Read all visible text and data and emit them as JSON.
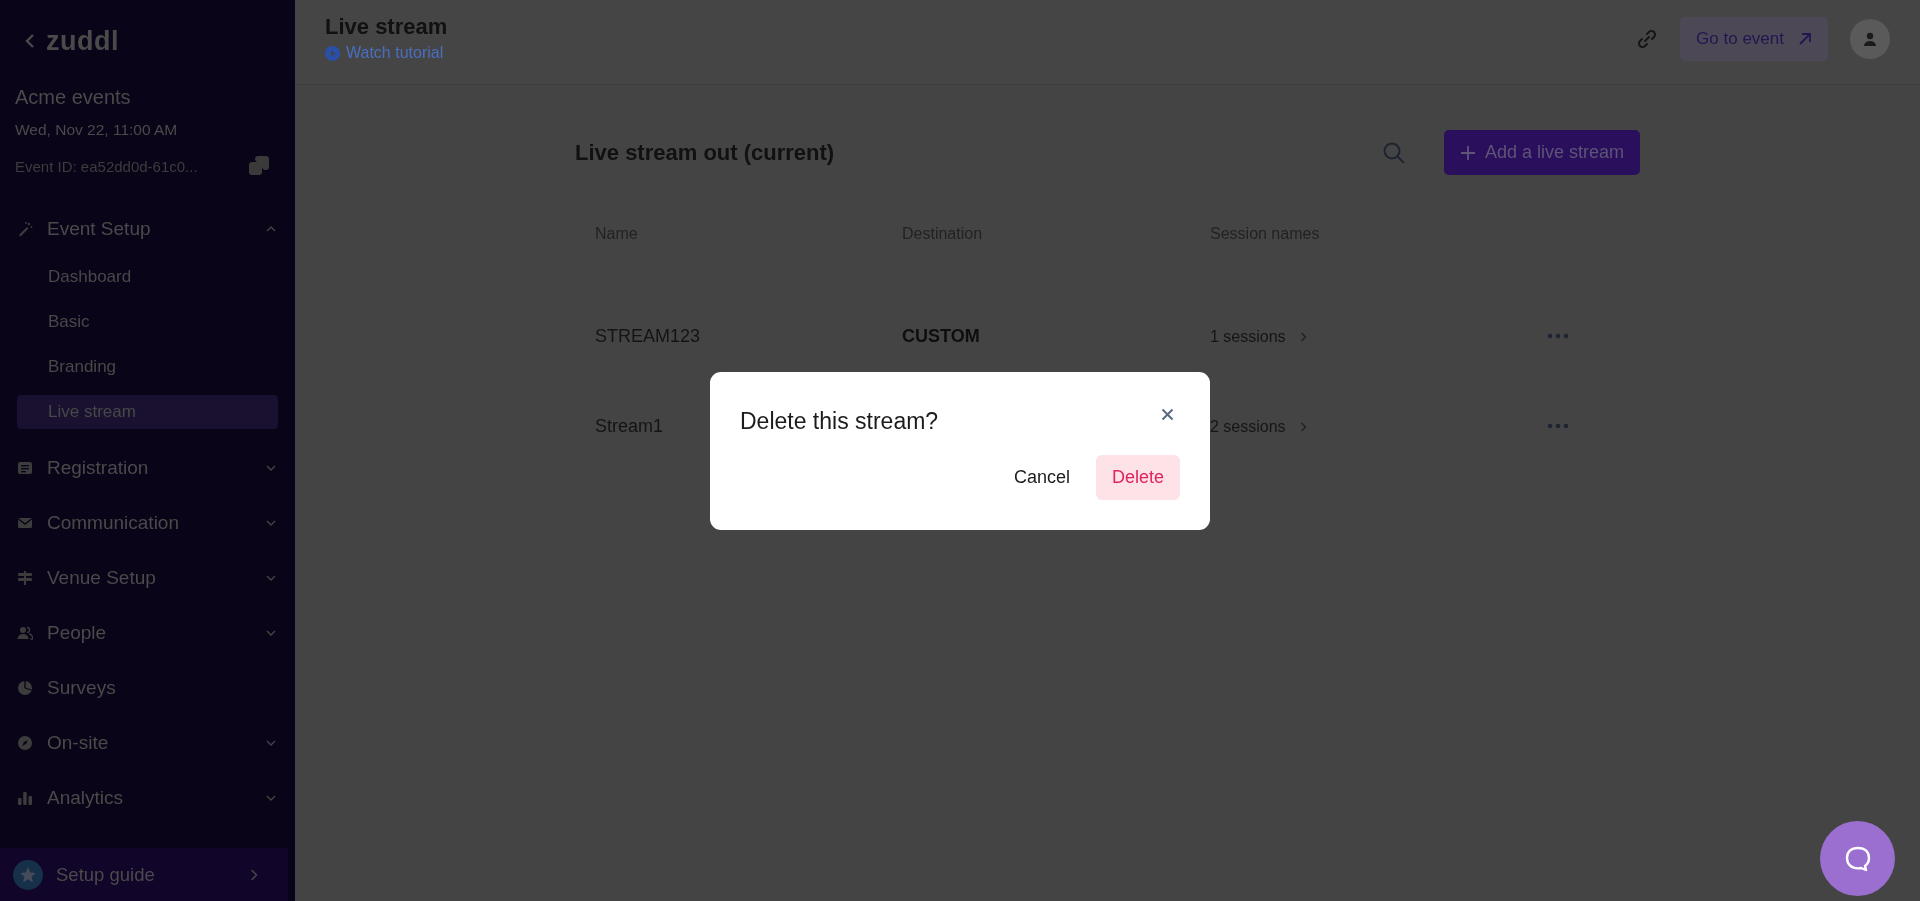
{
  "sidebar": {
    "logo": "zuddl",
    "event_name": "Acme events",
    "event_date": "Wed, Nov 22, 11:00 AM",
    "event_id": "Event ID: ea52dd0d-61c0...",
    "nav": [
      {
        "label": "Event Setup",
        "kind": "group",
        "expanded": true,
        "children": [
          {
            "label": "Dashboard",
            "selected": false
          },
          {
            "label": "Basic",
            "selected": false
          },
          {
            "label": "Branding",
            "selected": false
          },
          {
            "label": "Live stream",
            "selected": true
          }
        ]
      },
      {
        "label": "Registration",
        "kind": "group",
        "expanded": false
      },
      {
        "label": "Communication",
        "kind": "group",
        "expanded": false
      },
      {
        "label": "Venue Setup",
        "kind": "group",
        "expanded": false
      },
      {
        "label": "People",
        "kind": "group",
        "expanded": false
      },
      {
        "label": "Surveys",
        "kind": "link"
      },
      {
        "label": "On-site",
        "kind": "group",
        "expanded": false
      },
      {
        "label": "Analytics",
        "kind": "group",
        "expanded": false
      }
    ],
    "setup_guide": "Setup guide"
  },
  "header": {
    "title": "Live stream",
    "tutorial_link": "Watch tutorial",
    "go_to_event": "Go to event"
  },
  "section": {
    "title": "Live stream out (current)",
    "add_button": "Add a live stream",
    "columns": [
      "Name",
      "Destination",
      "Session names"
    ],
    "rows": [
      {
        "name": "STREAM123",
        "destination": "CUSTOM",
        "sessions": "1 sessions"
      },
      {
        "name": "Stream1",
        "sessions": "2 sessions"
      }
    ]
  },
  "dialog": {
    "title": "Delete this stream?",
    "cancel": "Cancel",
    "delete": "Delete"
  }
}
